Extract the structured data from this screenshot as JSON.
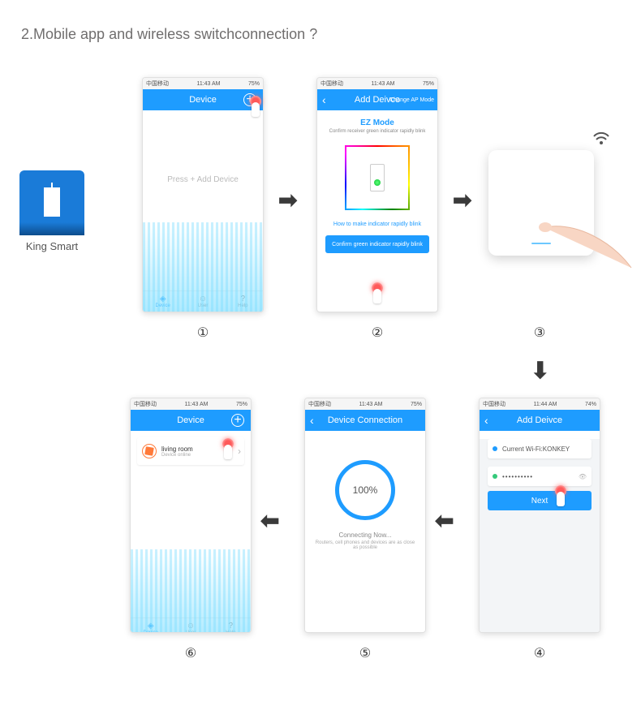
{
  "heading": "2.Mobile app and wireless switchconnection ?",
  "app": {
    "label": "King Smart"
  },
  "status": {
    "carrier": "中国移动",
    "time": "11:43 AM",
    "battery": "75%"
  },
  "status4": {
    "time": "11:44 AM",
    "battery": "74%"
  },
  "tabs": {
    "device": "Device",
    "user": "User",
    "help": "Help"
  },
  "step1": {
    "title": "Device",
    "hint": "Press + Add Device",
    "label": "①"
  },
  "step2": {
    "title": "Add Deivce",
    "right": "Change AP Mode",
    "mode": "EZ Mode",
    "sub": "Confirm receiver green indicator rapidly blink",
    "link": "How to make indicator rapidly blink",
    "btn": "Confirm green indicator rapidly blink",
    "label": "②"
  },
  "step3": {
    "label": "③"
  },
  "step4": {
    "title": "Add Deivce",
    "wifi_label": "Current Wi-Fi:",
    "wifi_name": "KONKEY",
    "password": "••••••••••",
    "next": "Next",
    "label": "④"
  },
  "step5": {
    "title": "Device Connection",
    "percent": "100%",
    "t1": "Connecting Now...",
    "t2": "Routers, cell phones and devices are as close as possible",
    "label": "⑤"
  },
  "step6": {
    "title": "Device",
    "room": "living room",
    "room_sub": "Device online",
    "label": "⑥"
  }
}
